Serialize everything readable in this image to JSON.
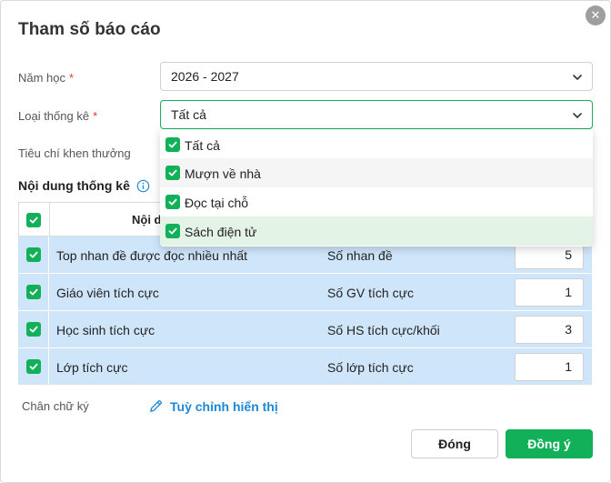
{
  "dialog": {
    "title": "Tham số báo cáo",
    "close_glyph": "✕"
  },
  "form": {
    "school_year": {
      "label": "Năm học",
      "required_mark": "*",
      "value": "2026 - 2027"
    },
    "stat_type": {
      "label": "Loại thống kê",
      "required_mark": "*",
      "value": "Tất cả"
    },
    "reward_criteria": {
      "label": "Tiêu chí khen thưởng"
    }
  },
  "dropdown": {
    "options": [
      {
        "label": "Tất cả",
        "checked": true
      },
      {
        "label": "Mượn về nhà",
        "checked": true
      },
      {
        "label": "Đọc tại chỗ",
        "checked": true
      },
      {
        "label": "Sách điện tử",
        "checked": true
      }
    ]
  },
  "section": {
    "title": "Nội dung thống kê",
    "info_icon": "info-icon"
  },
  "table": {
    "header": {
      "col1": "Nội d"
    },
    "rows": [
      {
        "name": "Top nhan đề được đọc nhiều nhất",
        "metric": "Số nhan đề",
        "value": "5",
        "checked": true
      },
      {
        "name": "Giáo viên tích cực",
        "metric": "Số GV tích cực",
        "value": "1",
        "checked": true
      },
      {
        "name": "Học sinh tích cực",
        "metric": "Số HS tích cực/khối",
        "value": "3",
        "checked": true
      },
      {
        "name": "Lớp tích cực",
        "metric": "Số lớp tích cực",
        "value": "1",
        "checked": true
      }
    ]
  },
  "footer": {
    "signature_label": "Chân chữ ký",
    "customize_link": "Tuỳ chỉnh hiển thị",
    "close_button": "Đóng",
    "ok_button": "Đồng ý"
  },
  "colors": {
    "accent": "#13b05a",
    "row_highlight": "#cfe5fa",
    "link": "#1e88d8",
    "required": "#e53935"
  }
}
